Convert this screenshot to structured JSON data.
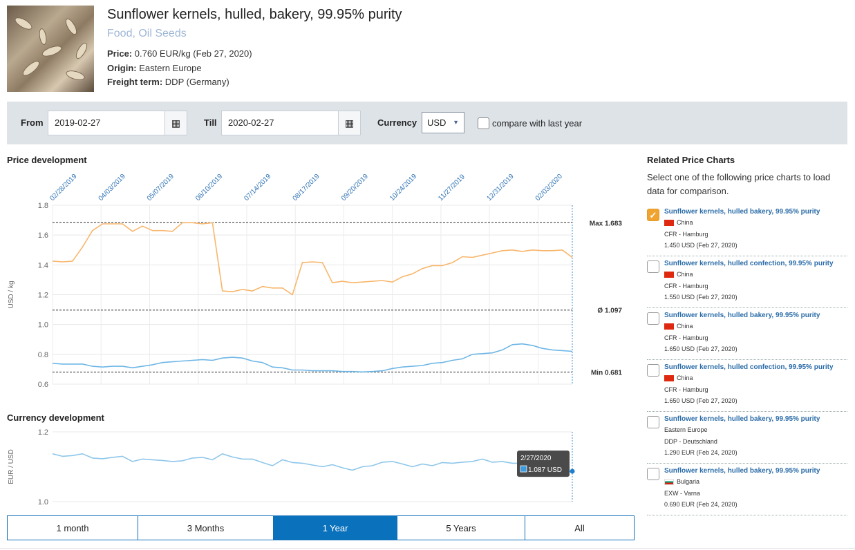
{
  "product": {
    "title": "Sunflower kernels, hulled, bakery, 99.95% purity",
    "category": "Food, Oil Seeds",
    "price_label": "Price:",
    "price_value": "0.760 EUR/kg (Feb 27, 2020)",
    "origin_label": "Origin:",
    "origin_value": "Eastern Europe",
    "freight_label": "Freight term:",
    "freight_value": "DDP (Germany)"
  },
  "filters": {
    "from_label": "From",
    "from_value": "2019-02-27",
    "till_label": "Till",
    "till_value": "2020-02-27",
    "currency_label": "Currency",
    "currency_value": "USD",
    "compare_label": "compare with last year",
    "calendar_icon": "calendar-icon",
    "calendar_glyph": "▦",
    "caret_glyph": "▼"
  },
  "price_chart_title": "Price development",
  "currency_chart_title": "Currency development",
  "chart_data": [
    {
      "type": "line",
      "title": "Price development",
      "ylabel": "USD / kg",
      "ylim": [
        0.6,
        1.8
      ],
      "yticks": [
        0.6,
        0.8,
        1.0,
        1.2,
        1.4,
        1.6,
        1.8
      ],
      "x_start": "2019-02-28",
      "x_end": "2020-02-27",
      "x_tick_labels": [
        "02/28/2019",
        "04/03/2019",
        "05/07/2019",
        "06/10/2019",
        "07/14/2019",
        "08/17/2019",
        "09/20/2019",
        "10/24/2019",
        "11/27/2019",
        "12/31/2019",
        "02/03/2020"
      ],
      "reference_lines": [
        {
          "label": "Max 1.683",
          "value": 1.683
        },
        {
          "label": "Ø 1.097",
          "value": 1.097
        },
        {
          "label": "Min 0.681",
          "value": 0.681
        }
      ],
      "series": [
        {
          "color": "#f8b66b",
          "x": [
            "2019-02-28",
            "2019-03-07",
            "2019-03-14",
            "2019-03-21",
            "2019-03-28",
            "2019-04-04",
            "2019-04-11",
            "2019-04-18",
            "2019-04-25",
            "2019-05-02",
            "2019-05-09",
            "2019-05-16",
            "2019-05-23",
            "2019-05-30",
            "2019-06-06",
            "2019-06-13",
            "2019-06-20",
            "2019-06-27",
            "2019-07-04",
            "2019-07-11",
            "2019-07-18",
            "2019-07-25",
            "2019-08-01",
            "2019-08-08",
            "2019-08-15",
            "2019-08-22",
            "2019-08-29",
            "2019-09-05",
            "2019-09-12",
            "2019-09-19",
            "2019-09-26",
            "2019-10-03",
            "2019-10-10",
            "2019-10-17",
            "2019-10-24",
            "2019-10-31",
            "2019-11-07",
            "2019-11-14",
            "2019-11-21",
            "2019-11-28",
            "2019-12-05",
            "2019-12-12",
            "2019-12-19",
            "2019-12-26",
            "2020-01-02",
            "2020-01-09",
            "2020-01-16",
            "2020-01-23",
            "2020-01-30",
            "2020-02-06",
            "2020-02-13",
            "2020-02-20",
            "2020-02-27"
          ],
          "values": [
            1.425,
            1.42,
            1.425,
            1.52,
            1.63,
            1.675,
            1.675,
            1.675,
            1.625,
            1.66,
            1.63,
            1.63,
            1.625,
            1.683,
            1.683,
            1.675,
            1.683,
            1.225,
            1.22,
            1.235,
            1.225,
            1.255,
            1.245,
            1.245,
            1.2,
            1.415,
            1.42,
            1.415,
            1.28,
            1.29,
            1.28,
            1.285,
            1.29,
            1.295,
            1.285,
            1.32,
            1.34,
            1.375,
            1.395,
            1.395,
            1.415,
            1.455,
            1.45,
            1.465,
            1.48,
            1.495,
            1.5,
            1.49,
            1.5,
            1.495,
            1.495,
            1.5,
            1.45
          ]
        },
        {
          "color": "#6eb6e6",
          "x": [
            "2019-02-28",
            "2019-03-07",
            "2019-03-14",
            "2019-03-21",
            "2019-03-28",
            "2019-04-04",
            "2019-04-11",
            "2019-04-18",
            "2019-04-25",
            "2019-05-02",
            "2019-05-09",
            "2019-05-16",
            "2019-05-23",
            "2019-05-30",
            "2019-06-06",
            "2019-06-13",
            "2019-06-20",
            "2019-06-27",
            "2019-07-04",
            "2019-07-11",
            "2019-07-18",
            "2019-07-25",
            "2019-08-01",
            "2019-08-08",
            "2019-08-15",
            "2019-08-22",
            "2019-08-29",
            "2019-09-05",
            "2019-09-12",
            "2019-09-19",
            "2019-09-26",
            "2019-10-03",
            "2019-10-10",
            "2019-10-17",
            "2019-10-24",
            "2019-10-31",
            "2019-11-07",
            "2019-11-14",
            "2019-11-21",
            "2019-11-28",
            "2019-12-05",
            "2019-12-12",
            "2019-12-19",
            "2019-12-26",
            "2020-01-02",
            "2020-01-09",
            "2020-01-16",
            "2020-01-23",
            "2020-01-30",
            "2020-02-06",
            "2020-02-13",
            "2020-02-20",
            "2020-02-27"
          ],
          "values": [
            0.74,
            0.735,
            0.735,
            0.735,
            0.72,
            0.715,
            0.72,
            0.72,
            0.71,
            0.72,
            0.73,
            0.745,
            0.75,
            0.755,
            0.76,
            0.765,
            0.76,
            0.775,
            0.78,
            0.775,
            0.755,
            0.745,
            0.715,
            0.71,
            0.695,
            0.695,
            0.69,
            0.69,
            0.69,
            0.685,
            0.685,
            0.682,
            0.685,
            0.69,
            0.705,
            0.715,
            0.72,
            0.725,
            0.74,
            0.745,
            0.76,
            0.77,
            0.8,
            0.805,
            0.81,
            0.83,
            0.865,
            0.87,
            0.86,
            0.84,
            0.83,
            0.825,
            0.82
          ]
        }
      ]
    },
    {
      "type": "line",
      "title": "Currency development",
      "ylabel": "EUR / USD",
      "ylim": [
        1.0,
        1.2
      ],
      "yticks": [
        1.0,
        1.2
      ],
      "x_start": "2019-02-28",
      "x_end": "2020-02-27",
      "series": [
        {
          "color": "#8ec6ea",
          "x": [
            "2019-02-28",
            "2019-03-07",
            "2019-03-14",
            "2019-03-21",
            "2019-03-28",
            "2019-04-04",
            "2019-04-11",
            "2019-04-18",
            "2019-04-25",
            "2019-05-02",
            "2019-05-09",
            "2019-05-16",
            "2019-05-23",
            "2019-05-30",
            "2019-06-06",
            "2019-06-13",
            "2019-06-20",
            "2019-06-27",
            "2019-07-04",
            "2019-07-11",
            "2019-07-18",
            "2019-07-25",
            "2019-08-01",
            "2019-08-08",
            "2019-08-15",
            "2019-08-22",
            "2019-08-29",
            "2019-09-05",
            "2019-09-12",
            "2019-09-19",
            "2019-09-26",
            "2019-10-03",
            "2019-10-10",
            "2019-10-17",
            "2019-10-24",
            "2019-10-31",
            "2019-11-07",
            "2019-11-14",
            "2019-11-21",
            "2019-11-28",
            "2019-12-05",
            "2019-12-12",
            "2019-12-19",
            "2019-12-26",
            "2020-01-02",
            "2020-01-09",
            "2020-01-16",
            "2020-01-23",
            "2020-01-30",
            "2020-02-06",
            "2020-02-13",
            "2020-02-20",
            "2020-02-27"
          ],
          "values": [
            1.137,
            1.13,
            1.132,
            1.137,
            1.125,
            1.123,
            1.127,
            1.13,
            1.115,
            1.122,
            1.12,
            1.118,
            1.115,
            1.117,
            1.125,
            1.127,
            1.12,
            1.137,
            1.128,
            1.122,
            1.122,
            1.112,
            1.103,
            1.12,
            1.112,
            1.11,
            1.105,
            1.1,
            1.106,
            1.097,
            1.09,
            1.1,
            1.103,
            1.113,
            1.115,
            1.108,
            1.1,
            1.108,
            1.103,
            1.112,
            1.11,
            1.113,
            1.115,
            1.122,
            1.113,
            1.115,
            1.11,
            1.11,
            1.107,
            1.097,
            1.085,
            1.087,
            1.087
          ]
        }
      ],
      "tooltip": {
        "date": "2/27/2020",
        "value_text": "1.087 USD"
      }
    }
  ],
  "range_tabs": [
    {
      "label": "1 month",
      "active": false
    },
    {
      "label": "3 Months",
      "active": false
    },
    {
      "label": "1 Year",
      "active": true
    },
    {
      "label": "5 Years",
      "active": false
    },
    {
      "label": "All",
      "active": false
    }
  ],
  "related": {
    "title": "Related Price Charts",
    "description": "Select one of the following price charts to load data for comparison.",
    "items": [
      {
        "name": "Sunflower kernels, hulled bakery, 99.95% purity",
        "country": "China",
        "flag": "cn",
        "freight": "CFR - Hamburg",
        "price": "1.450 USD (Feb 27, 2020)",
        "checked": true
      },
      {
        "name": "Sunflower kernels, hulled confection, 99.95% purity",
        "country": "China",
        "flag": "cn",
        "freight": "CFR - Hamburg",
        "price": "1.550 USD (Feb 27, 2020)",
        "checked": false
      },
      {
        "name": "Sunflower kernels, hulled bakery, 99.95% purity",
        "country": "China",
        "flag": "cn",
        "freight": "CFR - Hamburg",
        "price": "1.650 USD (Feb 27, 2020)",
        "checked": false
      },
      {
        "name": "Sunflower kernels, hulled confection, 99.95% purity",
        "country": "China",
        "flag": "cn",
        "freight": "CFR - Hamburg",
        "price": "1.650 USD (Feb 27, 2020)",
        "checked": false
      },
      {
        "name": "Sunflower kernels, hulled bakery, 99.95% purity",
        "country": "Eastern Europe",
        "flag": "none",
        "freight": "DDP - Deutschland",
        "price": "1.290 EUR (Feb 24, 2020)",
        "checked": false
      },
      {
        "name": "Sunflower kernels, hulled bakery, 99.95% purity",
        "country": "Bulgaria",
        "flag": "bg",
        "freight": "EXW - Varna",
        "price": "0.690 EUR (Feb 24, 2020)",
        "checked": false
      }
    ]
  }
}
